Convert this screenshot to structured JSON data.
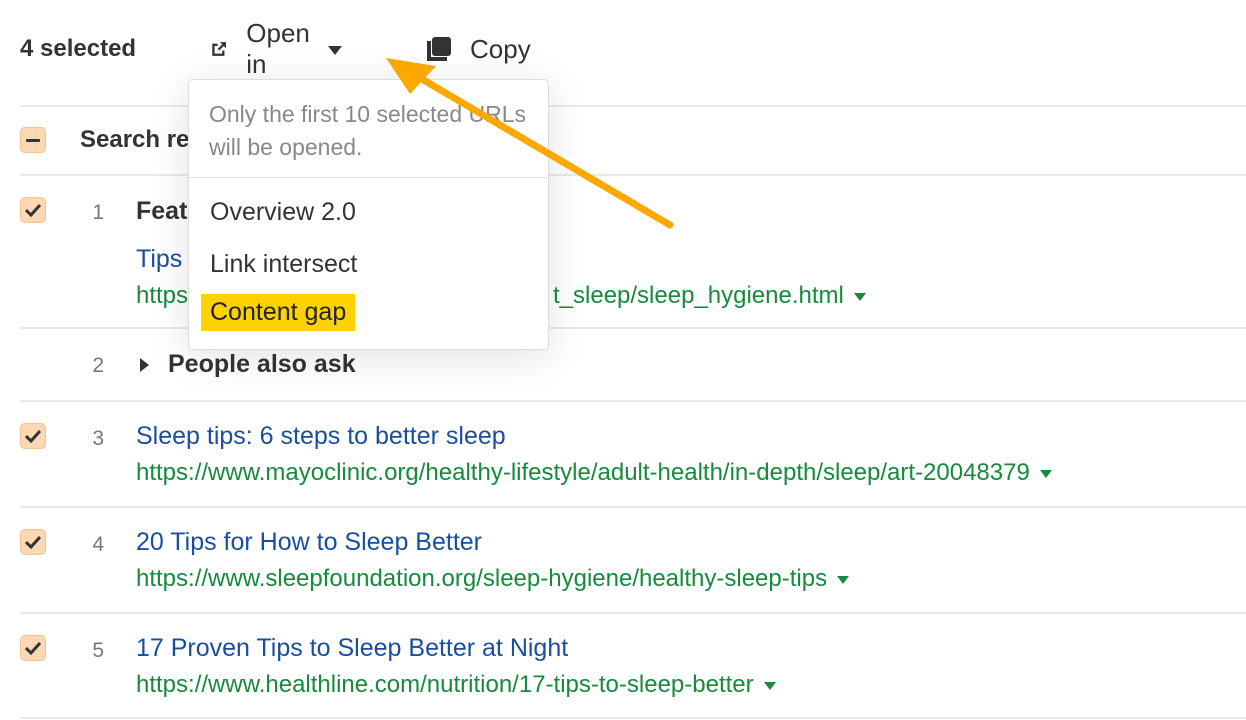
{
  "toolbar": {
    "selected_count": "4 selected",
    "open_in_label": "Open in",
    "copy_label": "Copy",
    "icons": {
      "open_in": "external-link-icon",
      "copy": "copy-icon"
    }
  },
  "dropdown": {
    "note": "Only the first 10 selected URLs will be opened.",
    "items": [
      {
        "label": "Overview 2.0",
        "active": false
      },
      {
        "label": "Link intersect",
        "active": false
      },
      {
        "label": "Content gap",
        "active": true
      }
    ]
  },
  "header": {
    "label": "Search results",
    "checkbox_state": "indeterminate"
  },
  "rows": [
    {
      "num": "1",
      "checked": true,
      "type_label": "Featured snippet",
      "title": "Tips for better sleep",
      "url": "https://www.sleepfoundation.org/.../healthy_sleep_tips/sleep_hygiene.html",
      "url_visible_end": "t_sleep/sleep_hygiene.html"
    },
    {
      "num": "2",
      "checked": false,
      "type_label": "People also ask"
    },
    {
      "num": "3",
      "checked": true,
      "title": "Sleep tips: 6 steps to better sleep",
      "url": "https://www.mayoclinic.org/healthy-lifestyle/adult-health/in-depth/sleep/art-20048379"
    },
    {
      "num": "4",
      "checked": true,
      "title": "20 Tips for How to Sleep Better",
      "url": "https://www.sleepfoundation.org/sleep-hygiene/healthy-sleep-tips"
    },
    {
      "num": "5",
      "checked": true,
      "title": "17 Proven Tips to Sleep Better at Night",
      "url": "https://www.healthline.com/nutrition/17-tips-to-sleep-better"
    }
  ],
  "colors": {
    "link_title": "#1a4ea0",
    "link_url": "#178a3c",
    "checkbox_fill": "#fcd8b3",
    "highlight": "#fcd202",
    "annotation_arrow": "#fba900"
  },
  "display": {
    "row1_type_visible": "Feat",
    "row1_title_visible": "Tips",
    "row1_url_visible_start": "https:",
    "header_label_visible": "Search re"
  }
}
